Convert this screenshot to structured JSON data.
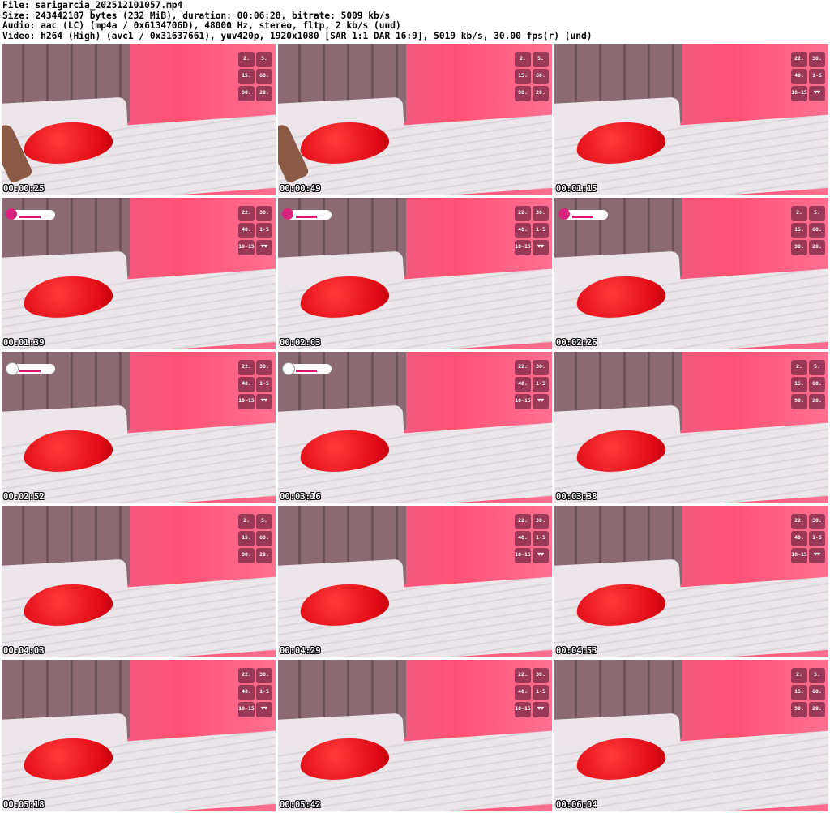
{
  "header": {
    "file": "File: sarigarcia_202512101057.mp4",
    "size": "Size: 243442187 bytes (232 MiB), duration: 00:06:28, bitrate: 5009 kb/s",
    "audio": "Audio: aac (LC) (mp4a / 0x6134706D), 48000 Hz, stereo, fltp, 2 kb/s (und)",
    "video": "Video: h264 (High) (avc1 / 0x31637661), yuv420p, 1920x1080 [SAR 1:1 DAR 16:9], 5019 kb/s, 30.00 fps(r) (und)"
  },
  "tips_a": [
    "2.",
    "5.",
    "15.",
    "60.",
    "90.",
    "20."
  ],
  "tips_b": [
    "22.",
    "30.",
    "40.",
    "1-5",
    "10~15",
    "♥♥"
  ],
  "thumbnails": [
    {
      "timestamp": "00:00:25",
      "tips": "a",
      "badge": "none",
      "hand": true
    },
    {
      "timestamp": "00:00:49",
      "tips": "a",
      "badge": "none",
      "hand": true
    },
    {
      "timestamp": "00:01:15",
      "tips": "b",
      "badge": "none",
      "hand": false
    },
    {
      "timestamp": "00:01:39",
      "tips": "b",
      "badge": "instagram",
      "hand": false
    },
    {
      "timestamp": "00:02:03",
      "tips": "b",
      "badge": "instagram",
      "hand": false
    },
    {
      "timestamp": "00:02:26",
      "tips": "a",
      "badge": "instagram",
      "hand": false
    },
    {
      "timestamp": "00:02:52",
      "tips": "b",
      "badge": "x",
      "hand": false
    },
    {
      "timestamp": "00:03:16",
      "tips": "b",
      "badge": "x",
      "hand": false
    },
    {
      "timestamp": "00:03:38",
      "tips": "a",
      "badge": "none",
      "hand": false
    },
    {
      "timestamp": "00:04:03",
      "tips": "a",
      "badge": "none",
      "hand": false
    },
    {
      "timestamp": "00:04:29",
      "tips": "b",
      "badge": "none",
      "hand": false
    },
    {
      "timestamp": "00:04:53",
      "tips": "b",
      "badge": "none",
      "hand": false
    },
    {
      "timestamp": "00:05:18",
      "tips": "b",
      "badge": "none",
      "hand": false
    },
    {
      "timestamp": "00:05:42",
      "tips": "b",
      "badge": "none",
      "hand": false
    },
    {
      "timestamp": "00:06:04",
      "tips": "a",
      "badge": "none",
      "hand": false
    }
  ]
}
